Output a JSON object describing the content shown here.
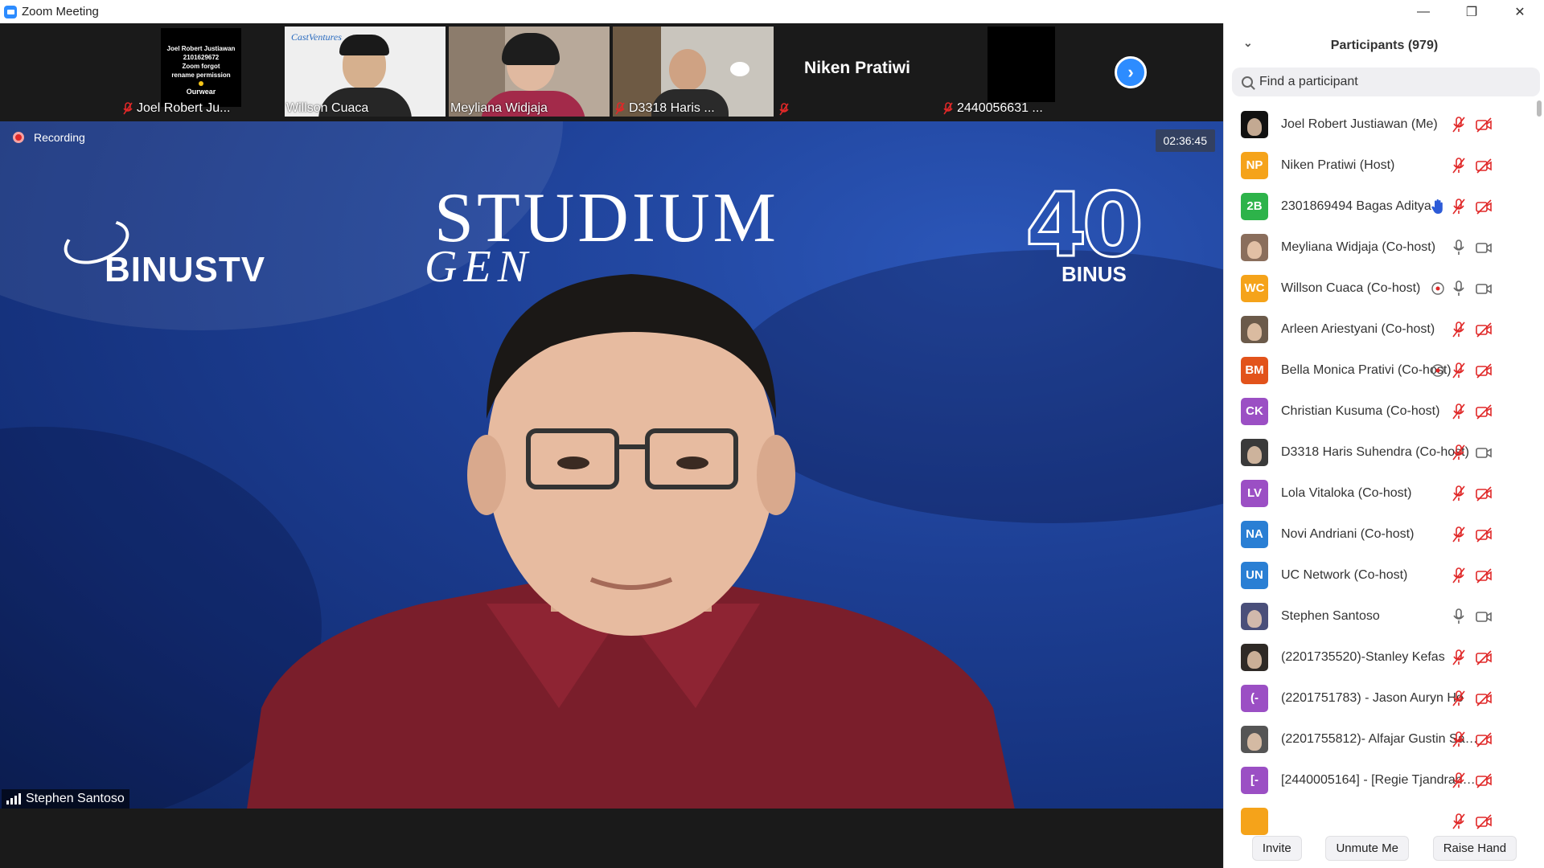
{
  "window": {
    "title": "Zoom Meeting",
    "minimize": "—",
    "maximize": "❐",
    "close": "✕"
  },
  "filmstrip": {
    "thumbs": [
      {
        "name": "Joel Robert Ju...",
        "muted": true,
        "card_lines": [
          "Joel Robert Justiawan",
          "2101629672",
          "Zoom forgot",
          "rename permission",
          "Ourwear"
        ]
      },
      {
        "name": "Willson Cuaca",
        "muted": false,
        "sign": "CastVentures"
      },
      {
        "name": "Meyliana Widjaja",
        "muted": false
      },
      {
        "name": "D3318 Haris ...",
        "muted": true
      },
      {
        "name": "Niken Pratiwi",
        "muted": true
      },
      {
        "name": "2440056631 ...",
        "muted": true
      }
    ],
    "next_icon": "›"
  },
  "main": {
    "recording": "Recording",
    "timer": "02:36:45",
    "brand_left": "BINUSTV",
    "brand_center_l1": "STUDIUM",
    "brand_center_l2": "GEN",
    "brand_right_num": "40",
    "brand_right_name": "BINUS",
    "speaker": "Stephen Santoso"
  },
  "panel": {
    "title": "Participants (979)",
    "search_placeholder": "Find a participant",
    "participants": [
      {
        "name": "Joel Robert Justiawan (Me)",
        "initials": "",
        "color": "#111111",
        "avatar_type": "photo-dark",
        "hand": false,
        "share": false,
        "mic": "muted",
        "cam": "off"
      },
      {
        "name": "Niken Pratiwi (Host)",
        "initials": "NP",
        "color": "#f5a31a",
        "hand": false,
        "share": false,
        "mic": "muted",
        "cam": "off"
      },
      {
        "name": "2301869494 Bagas Aditya",
        "initials": "2B",
        "color": "#2db34a",
        "hand": true,
        "share": false,
        "mic": "muted",
        "cam": "off"
      },
      {
        "name": "Meyliana Widjaja (Co-host)",
        "initials": "",
        "color": "#8a6e5c",
        "avatar_type": "photo",
        "hand": false,
        "share": false,
        "mic": "on",
        "cam": "on"
      },
      {
        "name": "Willson Cuaca (Co-host)",
        "initials": "WC",
        "color": "#f5a31a",
        "hand": false,
        "share": true,
        "mic": "on",
        "cam": "on"
      },
      {
        "name": "Arleen Ariestyani (Co-host)",
        "initials": "",
        "color": "#6b5a4a",
        "avatar_type": "photo",
        "hand": false,
        "share": false,
        "mic": "muted",
        "cam": "off"
      },
      {
        "name": "Bella Monica Prativi (Co-host)",
        "initials": "BM",
        "color": "#e2531b",
        "hand": false,
        "share": true,
        "mic": "muted",
        "cam": "off"
      },
      {
        "name": "Christian Kusuma (Co-host)",
        "initials": "CK",
        "color": "#9b4fc4",
        "hand": false,
        "share": false,
        "mic": "muted",
        "cam": "off"
      },
      {
        "name": "D3318 Haris Suhendra (Co-host)",
        "initials": "",
        "color": "#3a3a3a",
        "avatar_type": "photo",
        "hand": false,
        "share": false,
        "mic": "muted",
        "cam": "on"
      },
      {
        "name": "Lola Vitaloka (Co-host)",
        "initials": "LV",
        "color": "#9b4fc4",
        "hand": false,
        "share": false,
        "mic": "muted",
        "cam": "off"
      },
      {
        "name": "Novi Andriani (Co-host)",
        "initials": "NA",
        "color": "#2a7fd4",
        "hand": false,
        "share": false,
        "mic": "muted",
        "cam": "off"
      },
      {
        "name": "UC Network (Co-host)",
        "initials": "UN",
        "color": "#2a7fd4",
        "hand": false,
        "share": false,
        "mic": "muted",
        "cam": "off"
      },
      {
        "name": "Stephen Santoso",
        "initials": "",
        "color": "#4a4f7a",
        "avatar_type": "photo",
        "hand": false,
        "share": false,
        "mic": "on",
        "cam": "on"
      },
      {
        "name": "(2201735520)-Stanley Kefas",
        "initials": "",
        "color": "#2f2a26",
        "avatar_type": "photo",
        "hand": false,
        "share": false,
        "mic": "muted",
        "cam": "off"
      },
      {
        "name": "(2201751783) - Jason Auryn Ho",
        "initials": "(-",
        "color": "#9b4fc4",
        "hand": false,
        "share": false,
        "mic": "muted",
        "cam": "off"
      },
      {
        "name": "(2201755812)- Alfajar Gustin Sav...",
        "initials": "",
        "color": "#555555",
        "avatar_type": "badge",
        "hand": false,
        "share": false,
        "mic": "muted",
        "cam": "off"
      },
      {
        "name": "[2440005164] - [Regie Tjandrana...",
        "initials": "[-",
        "color": "#9b4fc4",
        "hand": false,
        "share": false,
        "mic": "muted",
        "cam": "off"
      },
      {
        "name": "",
        "initials": "",
        "color": "#f5a31a",
        "hand": false,
        "share": false,
        "mic": "muted",
        "cam": "off"
      }
    ],
    "buttons": {
      "invite": "Invite",
      "unmute": "Unmute Me",
      "raise_hand": "Raise Hand"
    }
  }
}
